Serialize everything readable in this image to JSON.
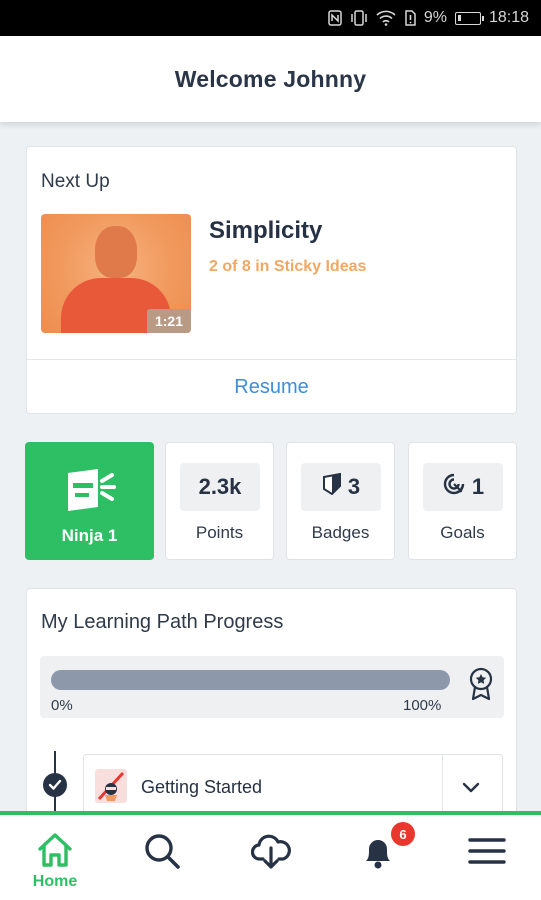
{
  "status_bar": {
    "battery": "9%",
    "time": "18:18"
  },
  "header": {
    "title": "Welcome Johnny"
  },
  "next_up": {
    "heading": "Next Up",
    "lesson_title": "Simplicity",
    "lesson_subtitle": "2 of 8 in Sticky Ideas",
    "duration": "1:21",
    "resume_label": "Resume"
  },
  "stats": {
    "rank_label": "Ninja 1",
    "points_value": "2.3k",
    "points_label": "Points",
    "badges_value": "3",
    "badges_label": "Badges",
    "goals_value": "1",
    "goals_label": "Goals"
  },
  "learning_path": {
    "heading": "My Learning Path Progress",
    "progress_min": "0%",
    "progress_max": "100%",
    "progress_fraction": 0,
    "module_label": "Getting Started"
  },
  "bottom_nav": {
    "home_label": "Home",
    "notification_count": "6"
  },
  "colors": {
    "accent_green": "#2ebf64",
    "link_blue": "#3f8ed6",
    "subtitle_orange": "#f0a862",
    "badge_red": "#e8382e"
  }
}
